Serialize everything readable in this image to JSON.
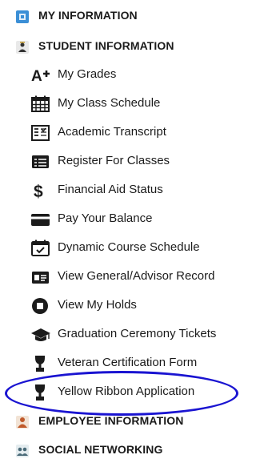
{
  "menu": {
    "my_information": "MY INFORMATION",
    "student_information": "STUDENT INFORMATION",
    "items": [
      {
        "label": "My Grades",
        "icon": "a-plus-icon"
      },
      {
        "label": "My Class Schedule",
        "icon": "calendar-grid-icon"
      },
      {
        "label": "Academic Transcript",
        "icon": "transcript-icon"
      },
      {
        "label": "Register For Classes",
        "icon": "register-list-icon"
      },
      {
        "label": "Financial Aid Status",
        "icon": "dollar-icon"
      },
      {
        "label": "Pay Your Balance",
        "icon": "credit-card-icon"
      },
      {
        "label": "Dynamic Course Schedule",
        "icon": "calendar-check-icon"
      },
      {
        "label": "View General/Advisor Record",
        "icon": "id-card-icon"
      },
      {
        "label": "View My Holds",
        "icon": "stop-circle-icon"
      },
      {
        "label": "Graduation Ceremony Tickets",
        "icon": "graduation-cap-icon"
      },
      {
        "label": "Veteran Certification Form",
        "icon": "trophy-icon"
      },
      {
        "label": "Yellow Ribbon Application",
        "icon": "trophy-icon"
      }
    ],
    "employee_information": "EMPLOYEE INFORMATION",
    "social_networking": "SOCIAL NETWORKING"
  },
  "colors": {
    "highlight_ellipse": "#1a14d1",
    "my_info_icon": "#3b8fd6",
    "icon_dark": "#1b1b1b"
  }
}
